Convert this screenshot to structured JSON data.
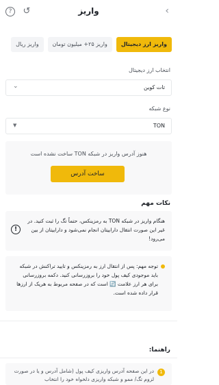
{
  "header": {
    "title": "واریز",
    "help_icon": "?",
    "history_icon": "↺",
    "back_icon": "‹"
  },
  "tabs": [
    {
      "label": "واریز ریال"
    },
    {
      "label": "واریز ۲۵+ میلیون تومان"
    },
    {
      "label": "واریز ارز دیجیتال"
    }
  ],
  "currency": {
    "label": "انتخاب ارز دیجیتال",
    "value": "تات کوین"
  },
  "network": {
    "label": "نوع شبکه",
    "value": "TON"
  },
  "notice": {
    "text": "هنوز آدرس واریز در شبکه TON ساخت نشده است",
    "button": "ساخت آدرس"
  },
  "important": {
    "title": "نکات مهم",
    "warning": "هنگام واریز در شبکه TON به رمزینکس، حتماً تگ را ثبت کنید. در غیر این صورت انتقال داراییتان انجام نمی‌شود و داراییتان از بین می‌رود!",
    "tip": "توجه مهم: پس از انتقال ارز به رمزینکس و تایید تراکنش در شبکه باید موجودی کیف پول خود را بروزرسانی کنید. دکمه بروزرسانی برای هر ارز علامت 🔄 است که در صفحه مربوط به هریک از ارزها قرار داده شده است."
  },
  "guide": {
    "title": "راهنما:",
    "step1": "در این صفحه آدرس واریزی کیف پول (شامل آدرس و یا در صورت لزوم تگ/ ممو و شبکه واریزی دلخواه خود را انتخاب",
    "step1_num": "1"
  },
  "colors": {
    "accent": "#f0b90b"
  }
}
